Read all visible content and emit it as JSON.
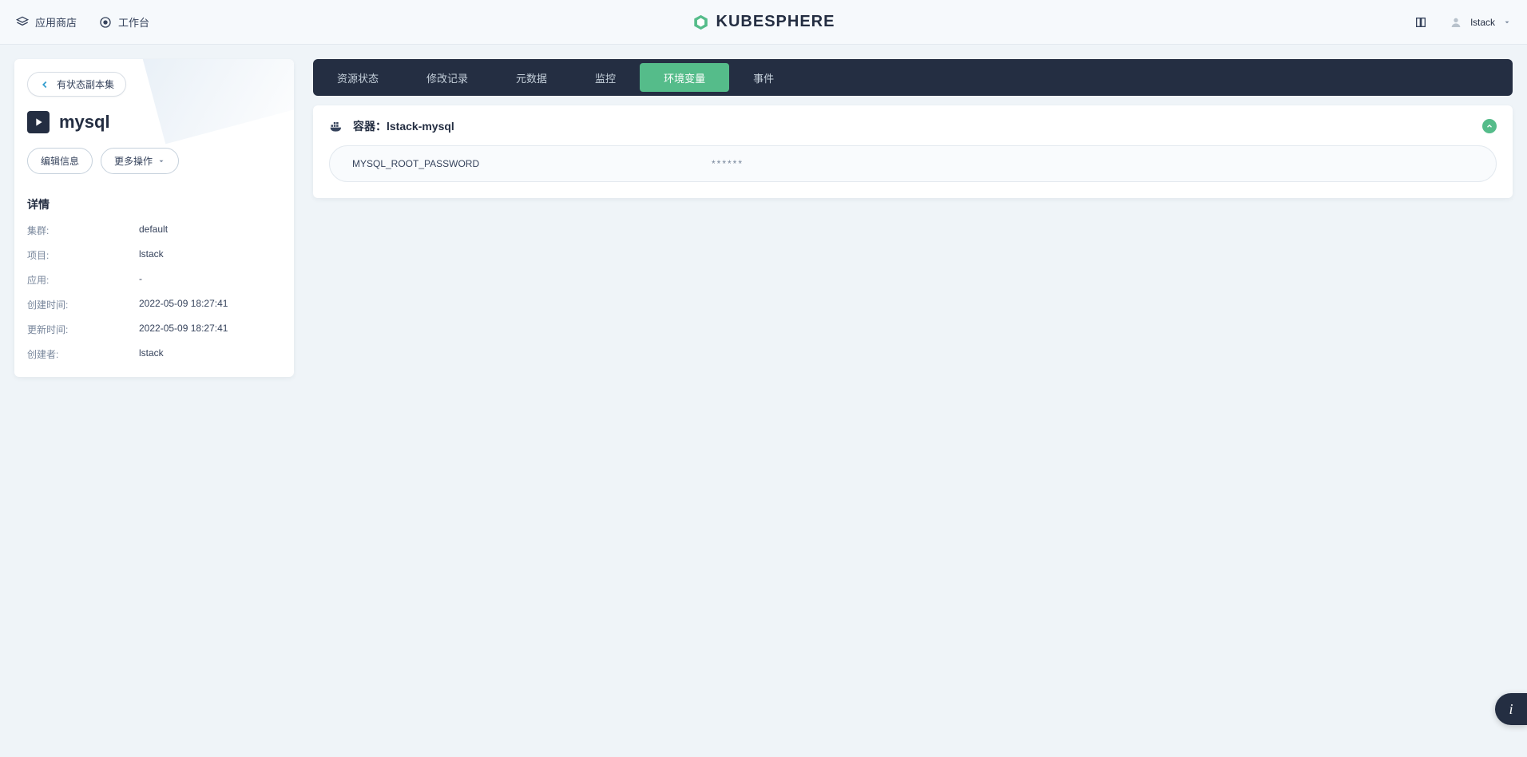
{
  "header": {
    "app_store": "应用商店",
    "workbench": "工作台",
    "brand": "KUBESPHERE",
    "username": "lstack"
  },
  "side": {
    "breadcrumb": "有状态副本集",
    "title": "mysql",
    "btn_edit": "编辑信息",
    "btn_more": "更多操作",
    "section_title": "详情",
    "details": [
      {
        "key": "集群:",
        "val": "default"
      },
      {
        "key": "项目:",
        "val": "lstack"
      },
      {
        "key": "应用:",
        "val": "-"
      },
      {
        "key": "创建时间:",
        "val": "2022-05-09 18:27:41"
      },
      {
        "key": "更新时间:",
        "val": "2022-05-09 18:27:41"
      },
      {
        "key": "创建者:",
        "val": "lstack"
      }
    ]
  },
  "tabs": [
    {
      "label": "资源状态",
      "active": false
    },
    {
      "label": "修改记录",
      "active": false
    },
    {
      "label": "元数据",
      "active": false
    },
    {
      "label": "监控",
      "active": false
    },
    {
      "label": "环境变量",
      "active": true
    },
    {
      "label": "事件",
      "active": false
    }
  ],
  "card": {
    "title_prefix": "容器：",
    "container_name": "lstack-mysql",
    "env": [
      {
        "key": "MYSQL_ROOT_PASSWORD",
        "val": "******"
      }
    ]
  },
  "fab": "i"
}
